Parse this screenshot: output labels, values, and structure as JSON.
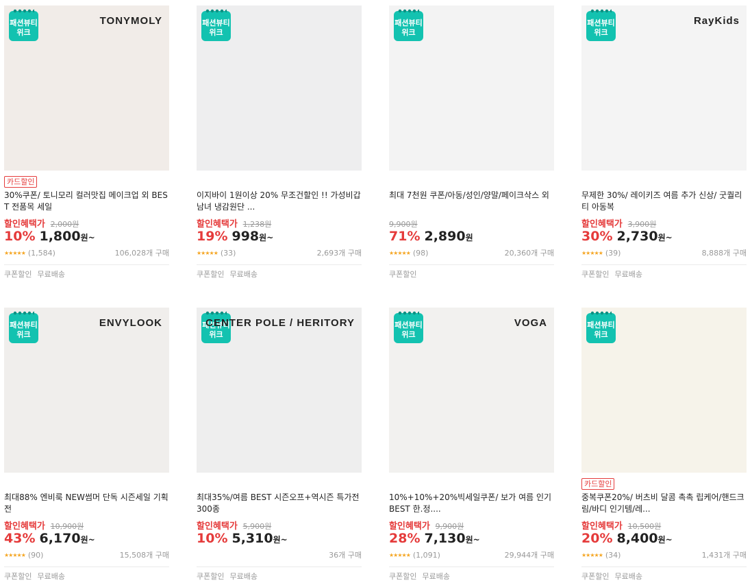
{
  "badge": {
    "line1": "패션뷰티",
    "line2": "위크"
  },
  "products": [
    {
      "brand": "TONYMOLY",
      "card_tag": "카드할인",
      "title": "30%쿠폰/ 토니모리 컬러맛집 메이크업 외 BEST 전품목 세일",
      "benefit_label": "할인혜택가",
      "original_price": "2,000원",
      "discount_rate": "10%",
      "price": "1,800",
      "price_unit": "원~",
      "rating_stars": "★★★★★",
      "reviews": "(1,584)",
      "purchases": "106,028개 구매",
      "tags": [
        "쿠폰할인",
        "무료배송"
      ],
      "image_tone": "#f1ece8"
    },
    {
      "brand": "",
      "card_tag": "",
      "title": "이지바이 1원이상 20% 무조건할인 !! 가성비갑 남녀 냉감원단 ...",
      "benefit_label": "할인혜택가",
      "original_price": "1,238원",
      "discount_rate": "19%",
      "price": "998",
      "price_unit": "원~",
      "rating_stars": "★★★★★",
      "reviews": "(33)",
      "purchases": "2,693개 구매",
      "tags": [
        "쿠폰할인",
        "무료배송"
      ],
      "image_tone": "#eeeeef"
    },
    {
      "brand": "",
      "card_tag": "",
      "title": "최대 7천원 쿠폰/아동/성인/양말/페이크삭스 외",
      "benefit_label": "",
      "original_price": "9,900원",
      "discount_rate": "71%",
      "price": "2,890",
      "price_unit": "원",
      "rating_stars": "★★★★★",
      "reviews": "(98)",
      "purchases": "20,360개 구매",
      "tags": [
        "쿠폰할인"
      ],
      "image_tone": "#f3f3f3"
    },
    {
      "brand": "RayKids",
      "card_tag": "",
      "title": "무제한 30%/ 레이키즈 여름 추가 신상/ 굿퀄리티 아동복",
      "benefit_label": "할인혜택가",
      "original_price": "3,900원",
      "discount_rate": "30%",
      "price": "2,730",
      "price_unit": "원~",
      "rating_stars": "★★★★★",
      "reviews": "(39)",
      "purchases": "8,888개 구매",
      "tags": [
        "쿠폰할인",
        "무료배송"
      ],
      "image_tone": "#f4f4f4"
    },
    {
      "brand": "ENVYLOOK",
      "card_tag": "",
      "title": "최대88% 엔비룩 NEW썸머 단독 시즌세일 기획전",
      "benefit_label": "할인혜택가",
      "original_price": "10,900원",
      "discount_rate": "43%",
      "price": "6,170",
      "price_unit": "원~",
      "rating_stars": "★★★★★",
      "reviews": "(90)",
      "purchases": "15,508개 구매",
      "tags": [
        "쿠폰할인",
        "무료배송"
      ],
      "image_tone": "#f0eeec"
    },
    {
      "brand": "CENTER POLE / HERITORY",
      "card_tag": "",
      "title": "최대35%/여름 BEST 시즌오프+역시즌 특가전 300종",
      "benefit_label": "할인혜택가",
      "original_price": "5,900원",
      "discount_rate": "10%",
      "price": "5,310",
      "price_unit": "원~",
      "rating_stars": "",
      "reviews": "",
      "purchases": "36개 구매",
      "tags": [
        "쿠폰할인",
        "무료배송"
      ],
      "image_tone": "#eeeeee"
    },
    {
      "brand": "VOGA",
      "card_tag": "",
      "title": "10%+10%+20%빅세일쿠폰/ 보가 여름 인기BEST 한.정....",
      "benefit_label": "할인혜택가",
      "original_price": "9,900원",
      "discount_rate": "28%",
      "price": "7,130",
      "price_unit": "원~",
      "rating_stars": "★★★★★",
      "reviews": "(1,091)",
      "purchases": "29,944개 구매",
      "tags": [
        "쿠폰할인",
        "무료배송"
      ],
      "image_tone": "#f2f1ef"
    },
    {
      "brand": "",
      "card_tag": "카드할인",
      "title": "중복쿠폰20%/ 버츠비 달콤 촉촉 립케어/핸드크림/바디 인기템/레...",
      "benefit_label": "할인혜택가",
      "original_price": "10,500원",
      "discount_rate": "20%",
      "price": "8,400",
      "price_unit": "원~",
      "rating_stars": "★★★★★",
      "reviews": "(34)",
      "purchases": "1,431개 구매",
      "tags": [
        "쿠폰할인",
        "무료배송"
      ],
      "image_tone": "#f6f3ea"
    }
  ]
}
